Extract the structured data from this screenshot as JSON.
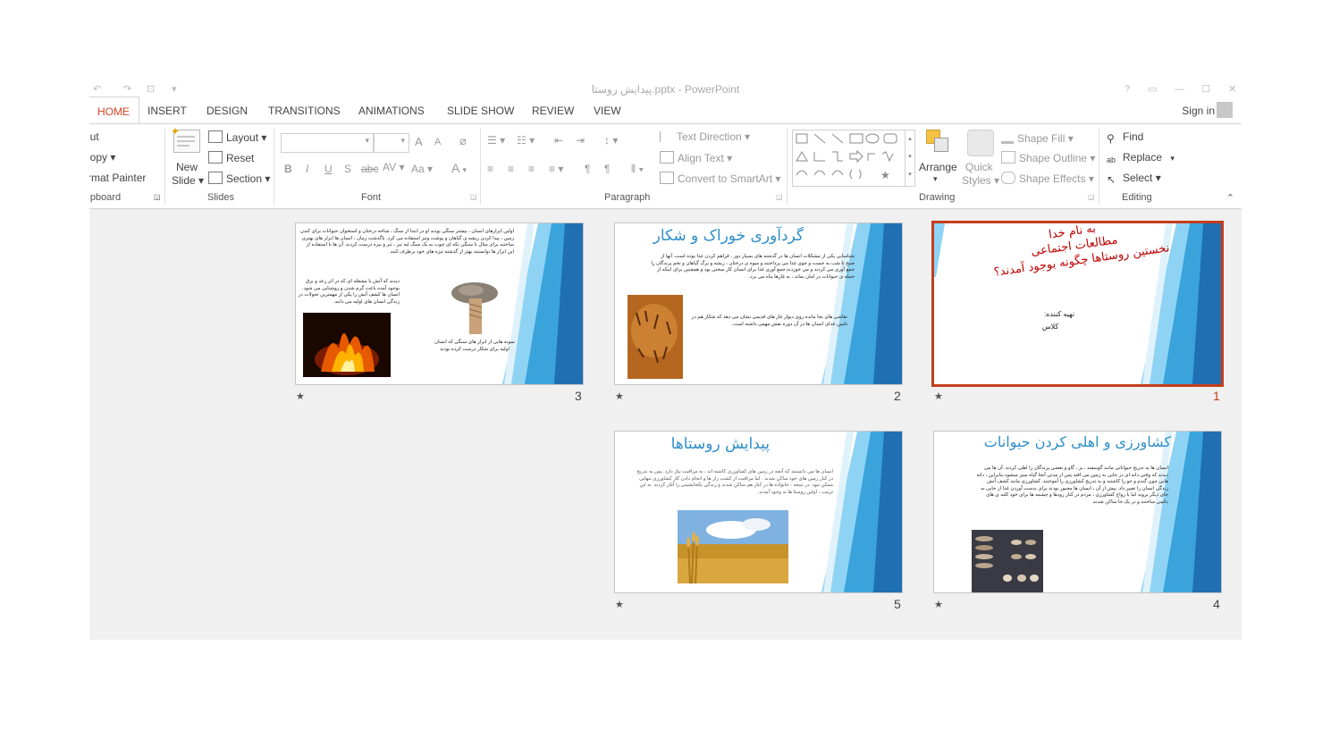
{
  "window": {
    "title": "پیدایش روستا.pptx - PowerPoint",
    "controls": [
      "?",
      "▭",
      "—",
      "☐",
      "✕"
    ]
  },
  "quick_access": [
    "↶",
    "↷",
    "⊡",
    "▾"
  ],
  "tabs": [
    "HOME",
    "INSERT",
    "DESIGN",
    "TRANSITIONS",
    "ANIMATIONS",
    "SLIDE SHOW",
    "REVIEW",
    "VIEW"
  ],
  "sign_in": "Sign in",
  "ribbon": {
    "clipboard": {
      "cut": "Cut",
      "copy": "Copy",
      "format_painter": "Format Painter",
      "label": "Clipboard"
    },
    "slides": {
      "new_slide_1": "New",
      "new_slide_2": "Slide",
      "layout": "Layout",
      "reset": "Reset",
      "section": "Section",
      "label": "Slides"
    },
    "font": {
      "label": "Font",
      "bold": "B",
      "italic": "I",
      "underline": "U",
      "shadow": "S",
      "strike": "abc",
      "spacing": "AV",
      "case": "Aa",
      "color": "A",
      "grow": "A",
      "shrink": "A"
    },
    "paragraph": {
      "text_direction": "Text Direction",
      "align_text": "Align Text",
      "smartart": "Convert to SmartArt",
      "label": "Paragraph"
    },
    "drawing": {
      "arrange": "Arrange",
      "quick_styles_1": "Quick",
      "quick_styles_2": "Styles",
      "shape_fill": "Shape Fill",
      "shape_outline": "Shape Outline",
      "shape_effects": "Shape Effects",
      "label": "Drawing"
    },
    "editing": {
      "find": "Find",
      "replace": "Replace",
      "select": "Select",
      "label": "Editing"
    }
  },
  "slides": [
    {
      "number": "1",
      "selected": true,
      "title_line1": "به نام خدا",
      "title_line2": "مطالعات اجتماعی",
      "title_line3": "نخستین روستاها چگونه بوجود آمدند؟",
      "prepared_by": "تهیه کننده:",
      "class_label": "کلاس"
    },
    {
      "number": "2",
      "title": "گردآوری خوراک و شکار",
      "body": "شناسایی یکی از مشکلات انسان ها در گذشته های بسیار دور ، فراهم کردن غذا بوده است. آنها از صبح تا شب به جست و جوی غذا می پرداختند و میوه ی درختان ، ریشه و برگ گیاهان و تخم پرندگان را جمع آوری می کردند و می خوردند.جمع آوری غذا برای انسان کار سختی بود و همچنین برای اینکه از حمله ی حیوانات در امان بماند ، به غارها پناه می برد.",
      "body2": "نقاشی های بجا مانده روی دیوار غار های قدیمی نشان می دهد که شکار هم در تامین غذای انسان ها در آن دوره نقش مهمی داشته است."
    },
    {
      "number": "3",
      "body": "اولین ابزارهای انسان ، بیشتر سنگی بودند او در ابتدا از سنگ ، شاخه درختان و استخوان حیوانات برای کندن زمین ، پیدا کردن ریشه ی گیاهان و پوشت وتیز استفاده می کرد. باگذشت زمان ، انسان ها ابزار های بهتری ساختند برای مثال با سنگی تکه ای چوب به یک سنگ لبه تیز ، تبر و نیزه درست کردند. آن ها با استفاده از این ابزار ها توانستند بهتر از گذشته تیزه های خود برطرف کنند.",
      "body2": "دیدند که آتش یا مشعله ای که در اثر رعد و برق بوجود آمده باعث گرم شدن و روشنایی می شود. انسان ها کشف آتش را یکی از مهمترین تحولات در زندگی انسان های اولیه می دانند.",
      "caption": "نمونه هایی از ابزار های سنگی که انسان اولیه برای شکار درست کرده بودند"
    },
    {
      "number": "4",
      "title": "کشاورزی و اهلی کردن حیوانات",
      "body": "انسان ها به تدریج حیواناتی مانند گوسفند ، بز ، گاو و بعضی پرندگان را اهلی کردند. آن ها می دیدند که وقتی دانه ای در جایی به زمین می افتد پس از مدتی آنجا گیاه سبز میشود.بنابراین ، دانه هایی چون گندم و جو را کاشتند و به تدریج کشاورزی را آموختند. کشاورزی مانند کشف آتش زندگی انسان را تغییر داد. پیش از آن ، انسان ها مجبور بودند برای بدست آوردن غذا از جایی به جای دیگر بروند اما با رواج کشاورزی ، مردم در کنار رودها و چشمه ها برای خود کلبه ی های دائمی ساختند و در یک جا ساکن شدند."
    },
    {
      "number": "5",
      "title": "پیدایش روستاها",
      "body": "انسان ها می دانستند که آنچه در زمین های کشاورزی کاشته اند ، به مراقبت نیاز دارد. پس به تدریج در کنار زمین های خود ساکن شدند . اما مراقبت از کشت زار ها و انجام دادن کار کشاورزی تنهایی ممکن نبود. در نتیجه ، خانواده ها در کنار هم ساکن شدند و زندگی یکجانشینی را آغاز کردند. به این ترتیب ، اولین روستا ها به وجود آمدند."
    }
  ],
  "colors": {
    "accent": "#d24726",
    "selected_border": "#c43e1c",
    "slide_blue_dark": "#1f6fb2",
    "slide_blue_mid": "#3aa3dc",
    "slide_blue_light": "#8fd3f4",
    "title_blue": "#2e8fc9",
    "title_red": "#c00000"
  },
  "icons": {
    "star": "★"
  }
}
